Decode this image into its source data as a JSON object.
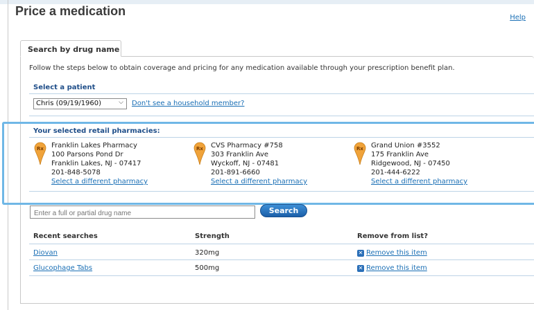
{
  "page": {
    "title": "Price a medication",
    "help_label": "Help"
  },
  "tab": {
    "label": "Search by drug name"
  },
  "intro": "Follow the steps below to obtain coverage and pricing for any medication available through your prescription benefit plan.",
  "patient": {
    "section_label": "Select a patient",
    "selected": "Chris (09/19/1960)",
    "household_link": "Don't see a household member?"
  },
  "pharmacies": {
    "section_label": "Your selected retail pharmacies:",
    "items": [
      {
        "name": "Franklin Lakes Pharmacy",
        "street": "100 Parsons Pond Dr",
        "city": "Franklin Lakes, NJ - 07417",
        "phone": "201-848-5078",
        "change_link": "Select a different pharmacy"
      },
      {
        "name": "CVS Pharmacy #758",
        "street": "303 Franklin Ave",
        "city": "Wyckoff, NJ - 07481",
        "phone": "201-891-6660",
        "change_link": "Select a different pharmacy"
      },
      {
        "name": "Grand Union #3552",
        "street": "175 Franklin Ave",
        "city": "Ridgewood, NJ - 07450",
        "phone": "201-444-6222",
        "change_link": "Select a different pharmacy"
      }
    ],
    "pin_color": "#f0a33a"
  },
  "search": {
    "placeholder": "Enter a full or partial drug name",
    "button_label": "Search"
  },
  "recent": {
    "headers": {
      "name": "Recent searches",
      "strength": "Strength",
      "remove": "Remove from list?"
    },
    "rows": [
      {
        "name": "Diovan",
        "strength": "320mg",
        "remove_label": "Remove this item"
      },
      {
        "name": "Glucophage Tabs",
        "strength": "500mg",
        "remove_label": "Remove this item"
      }
    ]
  },
  "colors": {
    "accent": "#1f4e89",
    "link": "#1a6fb5",
    "highlight": "#6fb7e6"
  }
}
